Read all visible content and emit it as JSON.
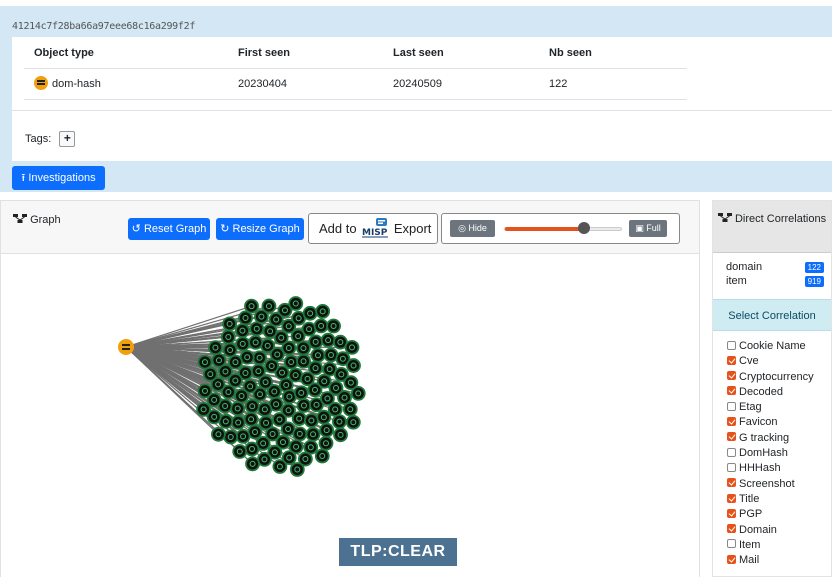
{
  "object": {
    "hash": "41214c7f28ba66a97eee68c16a299f2f",
    "table": {
      "headers": [
        "Object type",
        "First seen",
        "Last seen",
        "Nb seen"
      ],
      "row": [
        "dom-hash",
        "20230404",
        "20240509",
        "122"
      ]
    },
    "tags_label": "Tags:",
    "tag_add_symbol": "+"
  },
  "buttons": {
    "investigations": "Investigations",
    "reset_graph": "Reset Graph",
    "resize_graph": "Resize Graph",
    "add_to": "Add to",
    "export": "Export",
    "hide": "Hide",
    "full": "Full"
  },
  "graph": {
    "title": "Graph",
    "slider_value": 0.68,
    "accent_color": "#e6521b",
    "center_node_color": "#f0a00a",
    "leaf_node_color": "#1f7a3a",
    "leaf_count": 122
  },
  "tlp": "TLP:CLEAR",
  "sidebar": {
    "direct_title": "Direct Correlations",
    "correlations": [
      {
        "name": "domain",
        "count": "122"
      },
      {
        "name": "item",
        "count": "919"
      }
    ],
    "select_title": "Select Correlation",
    "options": [
      {
        "label": "Cookie Name",
        "checked": false
      },
      {
        "label": "Cve",
        "checked": true
      },
      {
        "label": "Cryptocurrency",
        "checked": true
      },
      {
        "label": "Decoded",
        "checked": true
      },
      {
        "label": "Etag",
        "checked": false
      },
      {
        "label": "Favicon",
        "checked": true
      },
      {
        "label": "G tracking",
        "checked": true
      },
      {
        "label": "DomHash",
        "checked": false
      },
      {
        "label": "HHHash",
        "checked": false
      },
      {
        "label": "Screenshot",
        "checked": true
      },
      {
        "label": "Title",
        "checked": true
      },
      {
        "label": "PGP",
        "checked": true
      },
      {
        "label": "Domain",
        "checked": true
      },
      {
        "label": "Item",
        "checked": false
      },
      {
        "label": "Mail",
        "checked": true
      }
    ]
  }
}
